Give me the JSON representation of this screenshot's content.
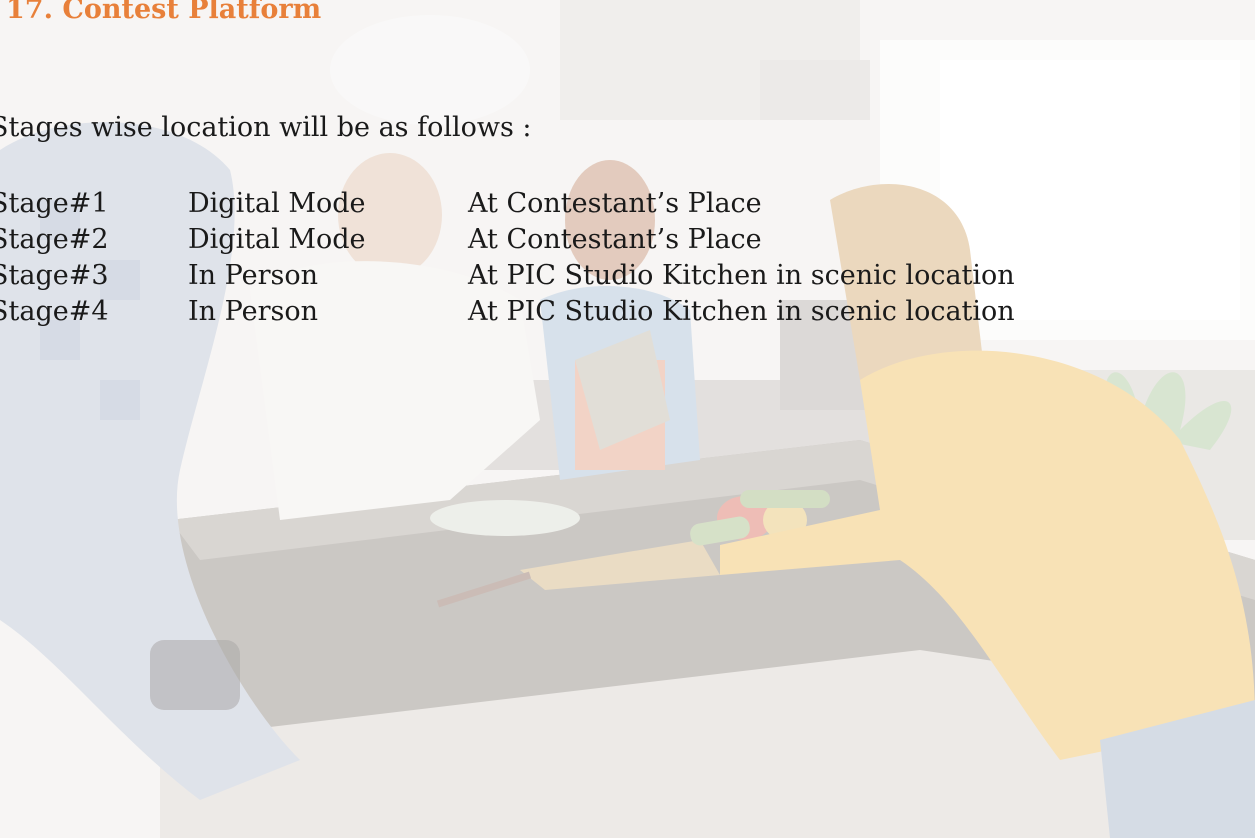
{
  "title": "17. Contest Platform",
  "intro": "Stages wise location will be as follows :",
  "stages": [
    {
      "stage": "Stage#1",
      "mode": "Digital Mode",
      "location": "At Contestant’s Place"
    },
    {
      "stage": "Stage#2",
      "mode": "Digital Mode",
      "location": "At Contestant’s Place"
    },
    {
      "stage": "Stage#3",
      "mode": "In Person",
      "location": "At PIC Studio Kitchen in scenic location"
    },
    {
      "stage": "Stage#4",
      "mode": "In Person",
      "location": "At PIC Studio Kitchen in scenic location"
    }
  ],
  "colors": {
    "title": "#e8803a",
    "text": "#1a1a1a"
  }
}
